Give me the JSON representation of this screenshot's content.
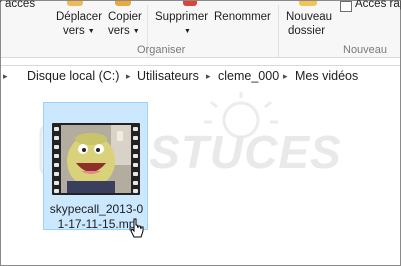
{
  "ribbon": {
    "top_left_fragment": "r accès",
    "move": {
      "line1": "Déplacer",
      "line2": "vers"
    },
    "copy": {
      "line1": "Copier",
      "line2": "vers"
    },
    "delete_label": "Supprimer",
    "rename_label": "Renommer",
    "new_folder": {
      "line1": "Nouveau",
      "line2": "dossier"
    },
    "easy_access_label": "Accès rapi",
    "organize_group": "Organiser",
    "new_group": "Nouveau"
  },
  "address": {
    "crumbs": [
      "Disque local (C:)",
      "Utilisateurs",
      "cleme_000",
      "Mes vidéos"
    ]
  },
  "file": {
    "name": "skypecall_2013-01-17-11-15.mp4",
    "name_visible": "skypecall_2013-0 1-17-11-15.mp"
  },
  "watermark": {
    "text": "PCASTUCES"
  },
  "colors": {
    "selection_bg": "#cce8ff",
    "selection_border": "#99d1ff",
    "ribbon_bg": "#f7f7f7"
  },
  "icons": [
    "move-to-icon",
    "copy-to-icon",
    "delete-icon",
    "new-folder-icon",
    "cursor-icon",
    "video-thumbnail-icon"
  ]
}
